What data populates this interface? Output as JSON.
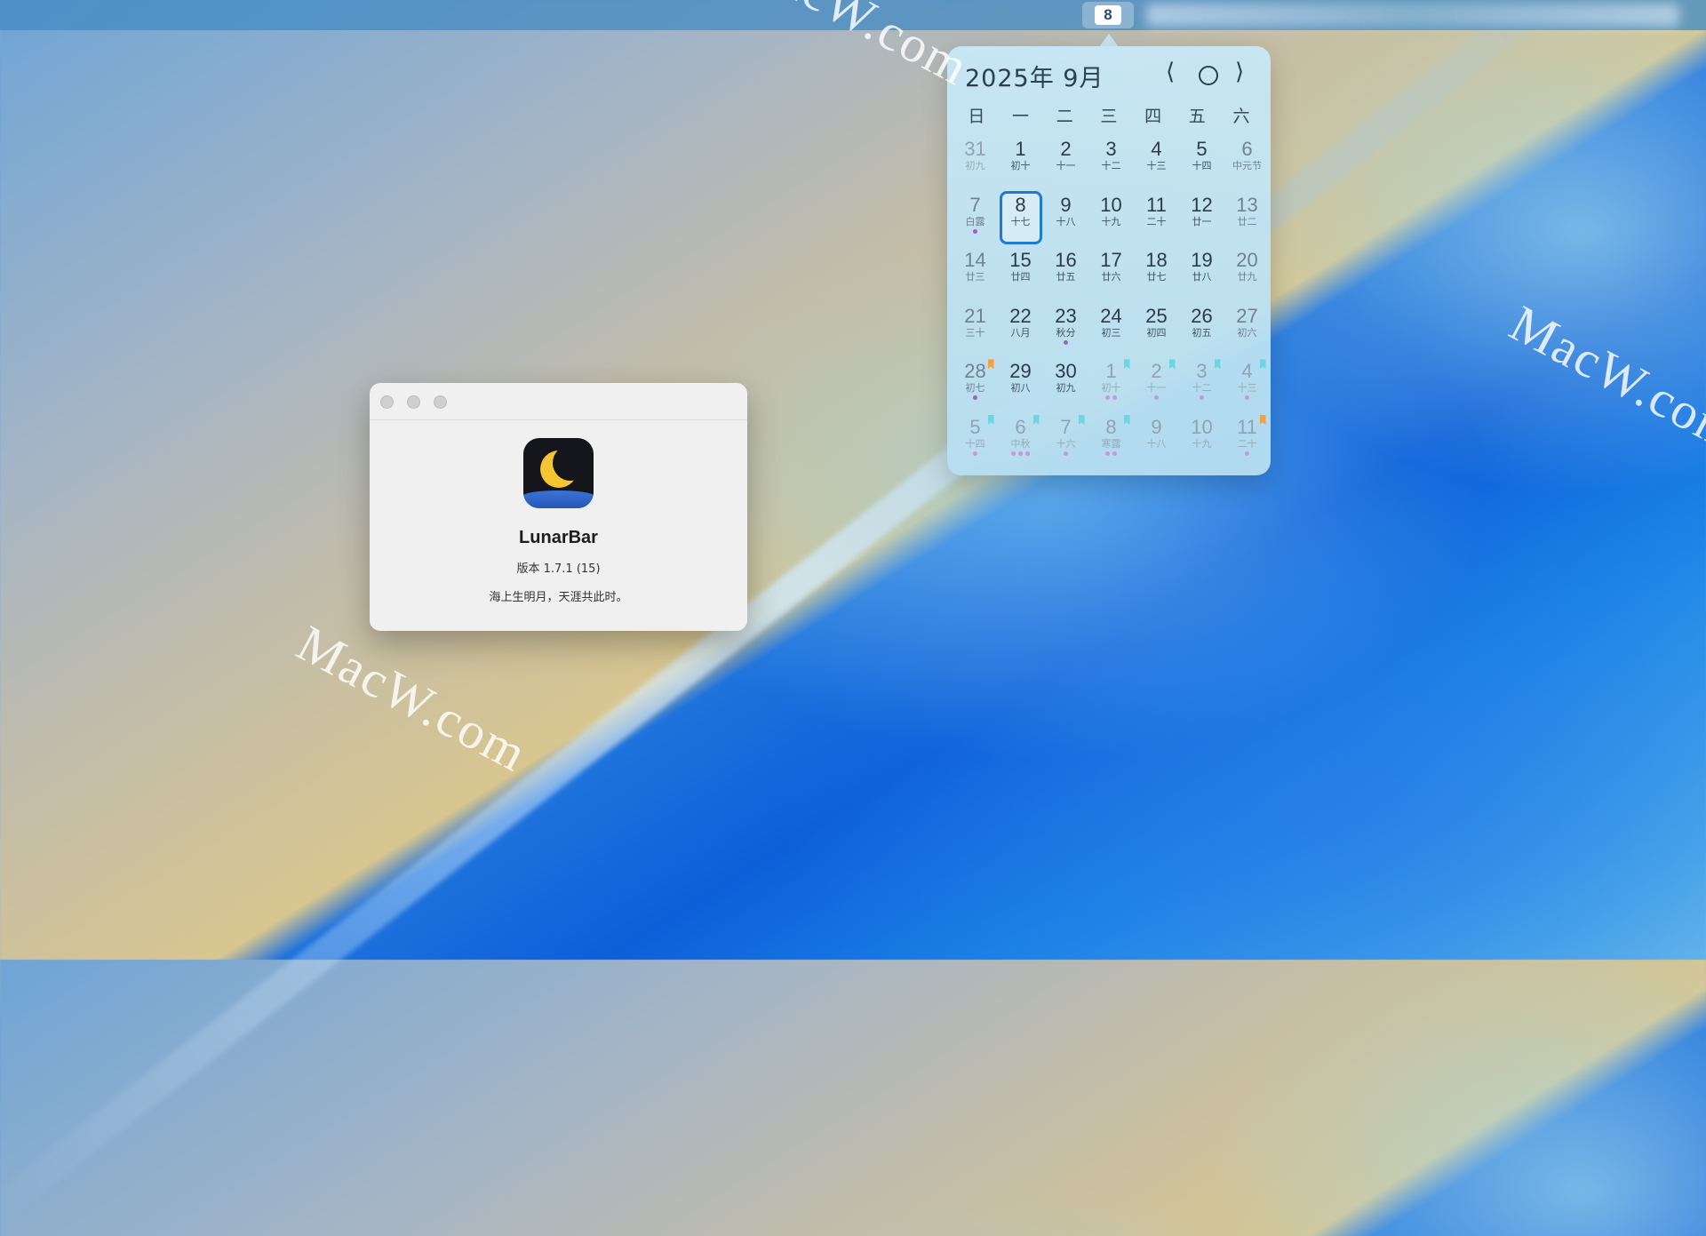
{
  "menubar": {
    "date_chip": "8"
  },
  "calendar": {
    "title": "2025年 9月",
    "prev": "⟨",
    "next": "⟩",
    "weekdays": [
      "日",
      "一",
      "二",
      "三",
      "四",
      "五",
      "六"
    ],
    "days": [
      {
        "d": "31",
        "l": "初九",
        "other": true
      },
      {
        "d": "1",
        "l": "初十"
      },
      {
        "d": "2",
        "l": "十一"
      },
      {
        "d": "3",
        "l": "十二"
      },
      {
        "d": "4",
        "l": "十三"
      },
      {
        "d": "5",
        "l": "十四"
      },
      {
        "d": "6",
        "l": "中元节"
      },
      {
        "d": "7",
        "l": "白露",
        "dots": 1
      },
      {
        "d": "8",
        "l": "十七",
        "today": true
      },
      {
        "d": "9",
        "l": "十八"
      },
      {
        "d": "10",
        "l": "十九"
      },
      {
        "d": "11",
        "l": "二十"
      },
      {
        "d": "12",
        "l": "廿一"
      },
      {
        "d": "13",
        "l": "廿二"
      },
      {
        "d": "14",
        "l": "廿三"
      },
      {
        "d": "15",
        "l": "廿四"
      },
      {
        "d": "16",
        "l": "廿五"
      },
      {
        "d": "17",
        "l": "廿六"
      },
      {
        "d": "18",
        "l": "廿七"
      },
      {
        "d": "19",
        "l": "廿八"
      },
      {
        "d": "20",
        "l": "廿九"
      },
      {
        "d": "21",
        "l": "三十"
      },
      {
        "d": "22",
        "l": "八月"
      },
      {
        "d": "23",
        "l": "秋分",
        "dots": 1
      },
      {
        "d": "24",
        "l": "初三"
      },
      {
        "d": "25",
        "l": "初四"
      },
      {
        "d": "26",
        "l": "初五"
      },
      {
        "d": "27",
        "l": "初六"
      },
      {
        "d": "28",
        "l": "初七",
        "dots": 1,
        "flag": "orange"
      },
      {
        "d": "29",
        "l": "初八"
      },
      {
        "d": "30",
        "l": "初九"
      },
      {
        "d": "1",
        "l": "初十",
        "other": true,
        "dots": 2,
        "flag": "teal"
      },
      {
        "d": "2",
        "l": "十一",
        "other": true,
        "dots": 1,
        "flag": "teal"
      },
      {
        "d": "3",
        "l": "十二",
        "other": true,
        "dots": 1,
        "flag": "teal"
      },
      {
        "d": "4",
        "l": "十三",
        "other": true,
        "dots": 1,
        "flag": "teal"
      },
      {
        "d": "5",
        "l": "十四",
        "other": true,
        "dots": 1,
        "flag": "teal"
      },
      {
        "d": "6",
        "l": "中秋",
        "other": true,
        "dots": 3,
        "flag": "teal"
      },
      {
        "d": "7",
        "l": "十六",
        "other": true,
        "dots": 1,
        "flag": "teal"
      },
      {
        "d": "8",
        "l": "寒露",
        "other": true,
        "dots": 2,
        "flag": "teal"
      },
      {
        "d": "9",
        "l": "十八",
        "other": true
      },
      {
        "d": "10",
        "l": "十九",
        "other": true
      },
      {
        "d": "11",
        "l": "二十",
        "other": true,
        "dots": 1,
        "flag": "orange"
      }
    ]
  },
  "about": {
    "app_name": "LunarBar",
    "version": "版本 1.7.1 (15)",
    "slogan": "海上生明月，天涯共此时。"
  },
  "watermarks": [
    "MacW.com",
    "MacW.com",
    "MacW.com"
  ]
}
